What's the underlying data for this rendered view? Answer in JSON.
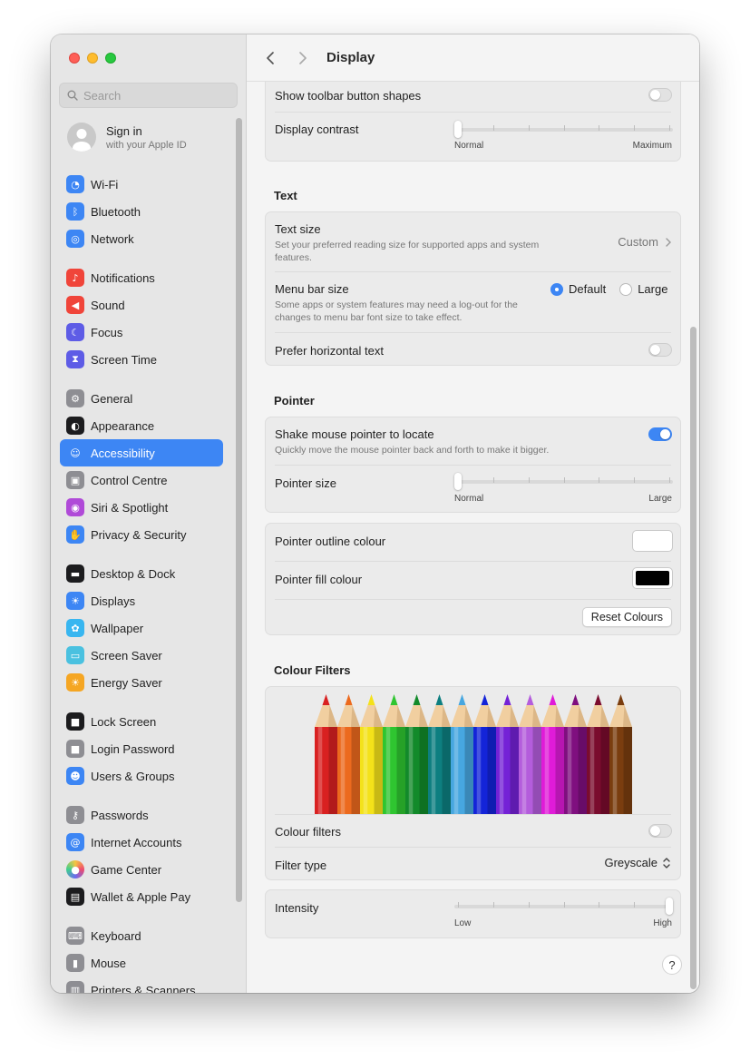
{
  "window": {
    "title": "Display",
    "search": {
      "placeholder": "Search"
    }
  },
  "sidebar": {
    "signin": {
      "title": "Sign in",
      "subtitle": "with your Apple ID"
    },
    "items": [
      {
        "label": "Wi-Fi",
        "icon": "wifi-icon",
        "color": "#3d86f4"
      },
      {
        "label": "Bluetooth",
        "icon": "bluetooth-icon",
        "color": "#3d86f4"
      },
      {
        "label": "Network",
        "icon": "globe-icon",
        "color": "#3d86f4"
      },
      {
        "label": "Notifications",
        "icon": "bell-icon",
        "color": "#f0453a"
      },
      {
        "label": "Sound",
        "icon": "speaker-icon",
        "color": "#f0453a"
      },
      {
        "label": "Focus",
        "icon": "moon-icon",
        "color": "#5e5ce6"
      },
      {
        "label": "Screen Time",
        "icon": "hourglass-icon",
        "color": "#5e5ce6"
      },
      {
        "label": "General",
        "icon": "gear-icon",
        "color": "#8e8e93"
      },
      {
        "label": "Appearance",
        "icon": "appearance-icon",
        "color": "#1c1c1e"
      },
      {
        "label": "Accessibility",
        "icon": "accessibility-icon",
        "color": "#3d86f4"
      },
      {
        "label": "Control Centre",
        "icon": "control-centre-icon",
        "color": "#8e8e93"
      },
      {
        "label": "Siri & Spotlight",
        "icon": "siri-icon",
        "color": "#b04ad8"
      },
      {
        "label": "Privacy & Security",
        "icon": "hand-icon",
        "color": "#3d86f4"
      },
      {
        "label": "Desktop & Dock",
        "icon": "dock-icon",
        "color": "#1c1c1e"
      },
      {
        "label": "Displays",
        "icon": "sun-icon",
        "color": "#3d86f4"
      },
      {
        "label": "Wallpaper",
        "icon": "flower-icon",
        "color": "#38b6f0"
      },
      {
        "label": "Screen Saver",
        "icon": "screen-saver-icon",
        "color": "#4ac1e0"
      },
      {
        "label": "Energy Saver",
        "icon": "lightbulb-icon",
        "color": "#f5a623"
      },
      {
        "label": "Lock Screen",
        "icon": "lock-icon",
        "color": "#1c1c1e"
      },
      {
        "label": "Login Password",
        "icon": "lock-icon",
        "color": "#8e8e93"
      },
      {
        "label": "Users & Groups",
        "icon": "users-icon",
        "color": "#3d86f4"
      },
      {
        "label": "Passwords",
        "icon": "key-icon",
        "color": "#8e8e93"
      },
      {
        "label": "Internet Accounts",
        "icon": "at-icon",
        "color": "#3d86f4"
      },
      {
        "label": "Game Center",
        "icon": "game-center-icon",
        "color": "#ffffff"
      },
      {
        "label": "Wallet & Apple Pay",
        "icon": "wallet-icon",
        "color": "#1c1c1e"
      },
      {
        "label": "Keyboard",
        "icon": "keyboard-icon",
        "color": "#8e8e93"
      },
      {
        "label": "Mouse",
        "icon": "mouse-icon",
        "color": "#8e8e93"
      },
      {
        "label": "Printers & Scanners",
        "icon": "printer-icon",
        "color": "#8e8e93"
      }
    ],
    "selected": "Accessibility"
  },
  "main": {
    "top_card": {
      "toolbar_shapes": {
        "label": "Show toolbar button shapes",
        "on": false
      },
      "contrast": {
        "label": "Display contrast",
        "min_label": "Normal",
        "max_label": "Maximum",
        "value": 0
      }
    },
    "text_section": {
      "title": "Text",
      "text_size": {
        "label": "Text size",
        "desc": "Set your preferred reading size for supported apps and system features.",
        "value": "Custom"
      },
      "menu_bar": {
        "label": "Menu bar size",
        "desc": "Some apps or system features may need a log-out for the changes to menu bar font size to take effect.",
        "options": [
          "Default",
          "Large"
        ],
        "selected": "Default"
      },
      "horizontal": {
        "label": "Prefer horizontal text",
        "on": false
      }
    },
    "pointer_section": {
      "title": "Pointer",
      "shake": {
        "label": "Shake mouse pointer to locate",
        "desc": "Quickly move the mouse pointer back and forth to make it bigger.",
        "on": true
      },
      "size": {
        "label": "Pointer size",
        "min_label": "Normal",
        "max_label": "Large",
        "value": 0
      },
      "outline": {
        "label": "Pointer outline colour",
        "color": "#ffffff"
      },
      "fill": {
        "label": "Pointer fill colour",
        "color": "#000000"
      },
      "reset": "Reset Colours"
    },
    "filters_section": {
      "title": "Colour Filters",
      "pencil_colors": [
        "#d92121",
        "#ec6a1e",
        "#f4e21a",
        "#2fc530",
        "#128a2a",
        "#0d7f80",
        "#47a7e0",
        "#1424d8",
        "#7422d6",
        "#b45ddc",
        "#e01bd8",
        "#7f0f7f",
        "#7a0c2e",
        "#7a3d0f"
      ],
      "filters": {
        "label": "Colour filters",
        "on": false
      },
      "type": {
        "label": "Filter type",
        "value": "Greyscale"
      },
      "intensity": {
        "label": "Intensity",
        "min_label": "Low",
        "max_label": "High",
        "value": 1
      }
    },
    "help": "?"
  }
}
